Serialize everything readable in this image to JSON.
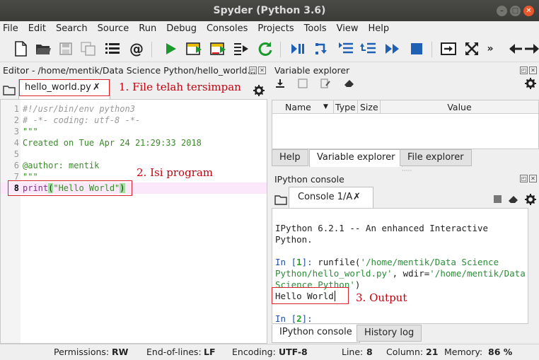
{
  "window": {
    "title": "Spyder (Python 3.6)"
  },
  "menu": [
    "File",
    "Edit",
    "Search",
    "Source",
    "Run",
    "Debug",
    "Consoles",
    "Projects",
    "Tools",
    "View",
    "Help"
  ],
  "editor": {
    "header": "Editor - /home/mentik/Data Science Python/hello_world...",
    "tab_label": "hello_world.py",
    "annotation": "1. File telah tersimpan",
    "lines": [
      {
        "n": "1",
        "text": "#!/usr/bin/env python3"
      },
      {
        "n": "2",
        "text": "# -*- coding: utf-8 -*-"
      },
      {
        "n": "3",
        "text": "\"\"\""
      },
      {
        "n": "4",
        "text": "Created on Tue Apr 24 21:29:33 2018"
      },
      {
        "n": "5",
        "text": ""
      },
      {
        "n": "6",
        "text": "@author: mentik"
      },
      {
        "n": "7",
        "text": "\"\"\""
      },
      {
        "n": "8",
        "kw": "print",
        "p1": "(",
        "str": "\"Hello World\"",
        "p2": ")"
      }
    ],
    "annotation2": "2. Isi program"
  },
  "varexp": {
    "header": "Variable explorer",
    "columns": [
      "Name",
      "Type",
      "Size",
      "Value"
    ],
    "tabs": [
      "Help",
      "Variable explorer",
      "File explorer"
    ]
  },
  "console": {
    "header": "IPython console",
    "tab_label": "Console 1/A",
    "banner1": "IPython 6.2.1 -- An enhanced Interactive",
    "banner2": "Python.",
    "in1_prompt": "In [",
    "in1_num": "1",
    "in1_close": "]: ",
    "in1_cmd": "runfile(",
    "in1_arg1": "'/home/mentik/Data Science",
    "in1_arg2": "Python/hello_world.py'",
    "in1_mid": ", wdir=",
    "in1_arg3": "'/home/mentik/Data",
    "in1_arg4": "Science Python'",
    "in1_end": ")",
    "output": "Hello World",
    "annotation3": "3. Output",
    "in2_prompt": "In [",
    "in2_num": "2",
    "in2_close": "]:",
    "bottom_tabs": [
      "IPython console",
      "History log"
    ]
  },
  "status": {
    "permissions_label": "Permissions:",
    "permissions": "RW",
    "eol_label": "End-of-lines:",
    "eol": "LF",
    "encoding_label": "Encoding:",
    "encoding": "UTF-8",
    "line_label": "Line:",
    "line": "8",
    "column_label": "Column:",
    "column": "21",
    "memory_label": "Memory:",
    "memory": "86 %"
  }
}
